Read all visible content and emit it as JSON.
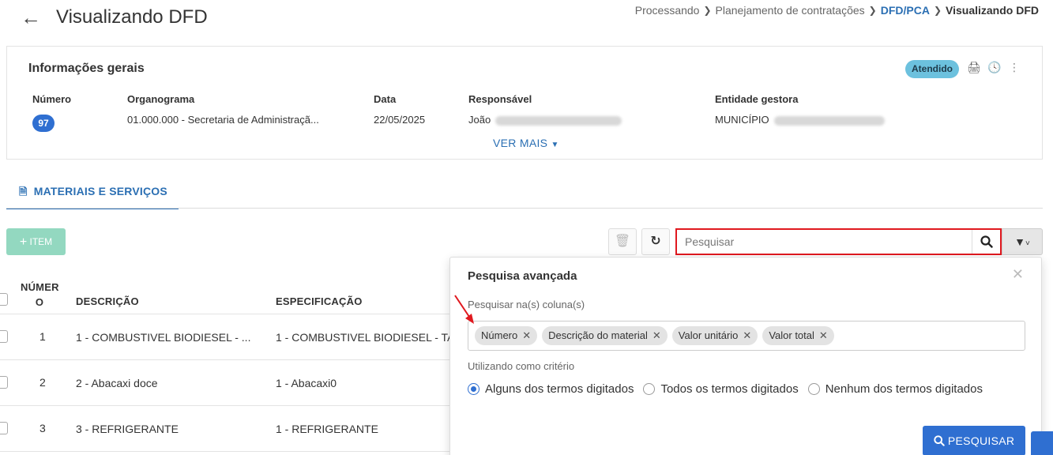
{
  "header": {
    "title": "Visualizando DFD",
    "breadcrumb": [
      "Processando",
      "Planejamento de contratações",
      "DFD/PCA",
      "Visualizando DFD"
    ]
  },
  "info": {
    "section_title": "Informações gerais",
    "status_badge": "Atendido",
    "fields": {
      "numero_label": "Número",
      "numero_value": "97",
      "organograma_label": "Organograma",
      "organograma_value": "01.000.000 - Secretaria de Administraçã...",
      "data_label": "Data",
      "data_value": "22/05/2025",
      "responsavel_label": "Responsável",
      "responsavel_value": "João",
      "entidade_label": "Entidade gestora",
      "entidade_value": "MUNICÍPIO"
    },
    "ver_mais": "VER MAIS"
  },
  "tabs": [
    {
      "label": "MATERIAIS E SERVIÇOS"
    }
  ],
  "toolbar": {
    "add_label": "ITEM",
    "search_placeholder": "Pesquisar"
  },
  "table": {
    "headers": {
      "numero": "NÚMER O",
      "descricao": "DESCRIÇÃO",
      "especificacao": "ESPECIFICAÇÃO"
    },
    "rows": [
      {
        "numero": "1",
        "descricao": "1 - COMBUSTIVEL BIODIESEL - ...",
        "especificacao": "1 - COMBUSTIVEL BIODIESEL - TA"
      },
      {
        "numero": "2",
        "descricao": "2 - Abacaxi doce",
        "especificacao": "1 - Abacaxi0"
      },
      {
        "numero": "3",
        "descricao": "3 - REFRIGERANTE",
        "especificacao": "1 - REFRIGERANTE"
      }
    ]
  },
  "advanced_search": {
    "title": "Pesquisa avançada",
    "columns_label": "Pesquisar na(s) coluna(s)",
    "tags": [
      "Número",
      "Descrição do material",
      "Valor unitário",
      "Valor total"
    ],
    "criteria_label": "Utilizando como critério",
    "options": [
      "Alguns dos termos digitados",
      "Todos os termos digitados",
      "Nenhum dos termos digitados"
    ],
    "selected_option": 0,
    "search_button": "PESQUISAR"
  },
  "colors": {
    "primary": "#2f6fd1",
    "highlight": "#e0191f",
    "badge": "#6cc1de",
    "add_button": "#93d8c0"
  }
}
